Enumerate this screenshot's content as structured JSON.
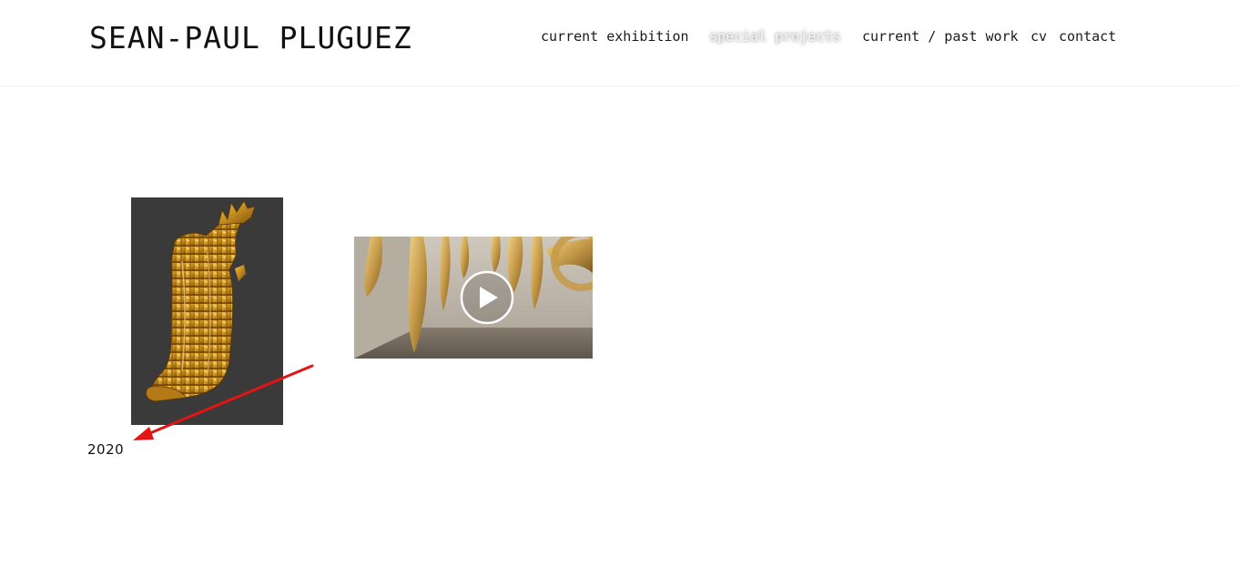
{
  "site": {
    "title": "SEAN-PAUL PLUGUEZ"
  },
  "nav": {
    "items": [
      {
        "label": "current exhibition",
        "active": false
      },
      {
        "label": "special projects",
        "active": true
      },
      {
        "label": "current / past work",
        "active": false
      },
      {
        "label": "cv",
        "active": false
      },
      {
        "label": "contact",
        "active": false
      }
    ]
  },
  "gallery": {
    "year": "2020",
    "video_play_icon": "play-icon"
  },
  "colors": {
    "annotation_arrow": "#e41414",
    "thumbnail_bg": "#3a3a3a",
    "gold": "#c8901f"
  }
}
